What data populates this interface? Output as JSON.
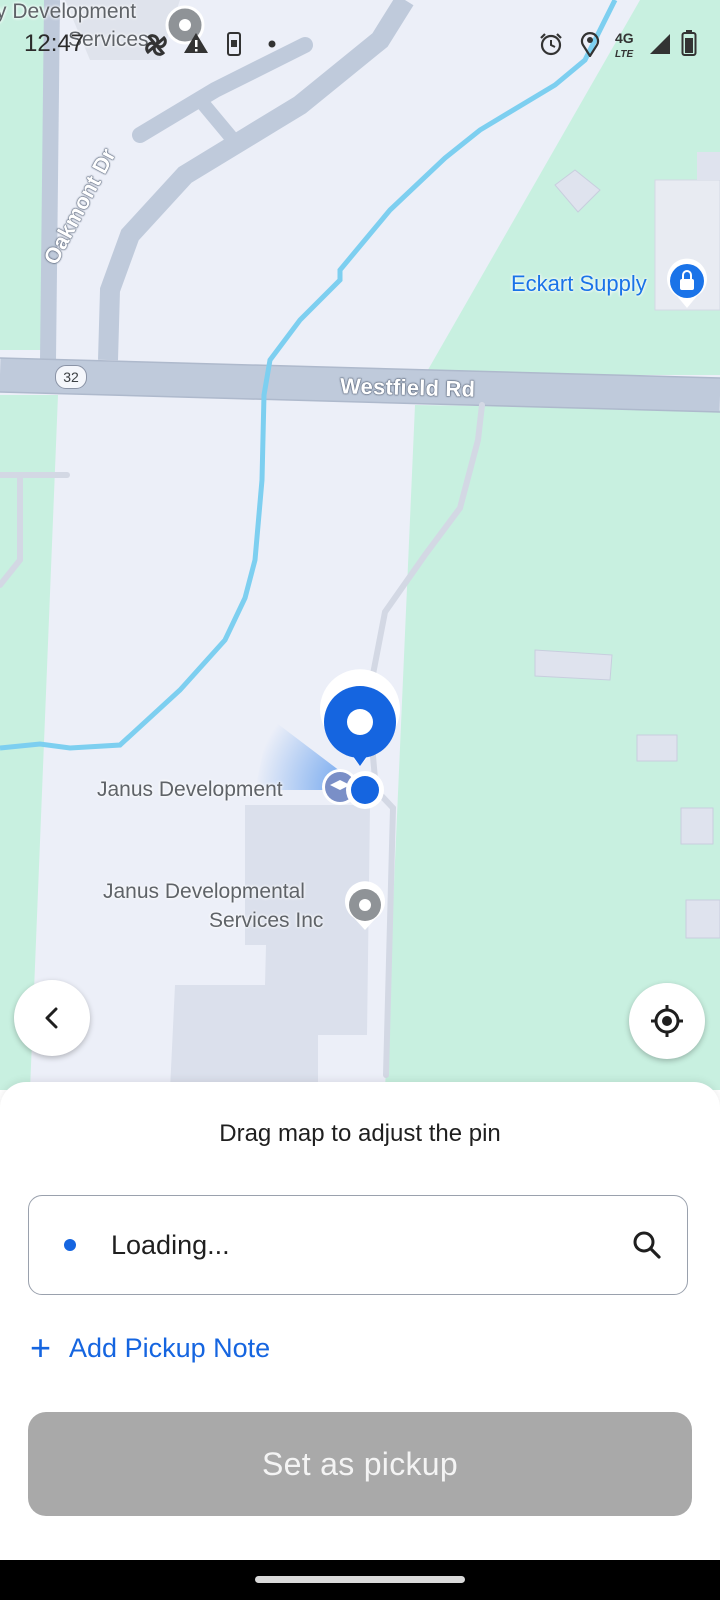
{
  "status_bar": {
    "time": "12:47",
    "icons": [
      "fan-icon",
      "warning-icon",
      "phone-icon",
      "dot-icon",
      "alarm-icon",
      "location-icon",
      "lte-icon",
      "signal-icon",
      "battery-icon"
    ],
    "network": "4G",
    "network_sub": "LTE"
  },
  "map": {
    "pois": {
      "top_left": "y Development Services",
      "top_left_line1": "y Development",
      "top_left_line2": "Services",
      "eckart": "Eckart Supply",
      "janus": "Janus Development",
      "janus_services_line1": "Janus Developmental",
      "janus_services_line2": "Services Inc"
    },
    "roads": {
      "oakmont": "Oakmont Dr",
      "westfield": "Westfield Rd",
      "route_number": "32"
    },
    "colors": {
      "land": "#eceff8",
      "park": "#c8f0e0",
      "road": "#bfcadb",
      "water": "#7dcff0",
      "pin": "#1565e0"
    }
  },
  "controls": {
    "back": "chevron-left-icon",
    "recenter": "crosshair-icon"
  },
  "sheet": {
    "hint": "Drag map to adjust the pin",
    "search_value": "Loading...",
    "add_note_label": "Add Pickup Note",
    "set_pickup_label": "Set as pickup",
    "accent": "#1565e0",
    "disabled_button": "#a9a9a9"
  }
}
